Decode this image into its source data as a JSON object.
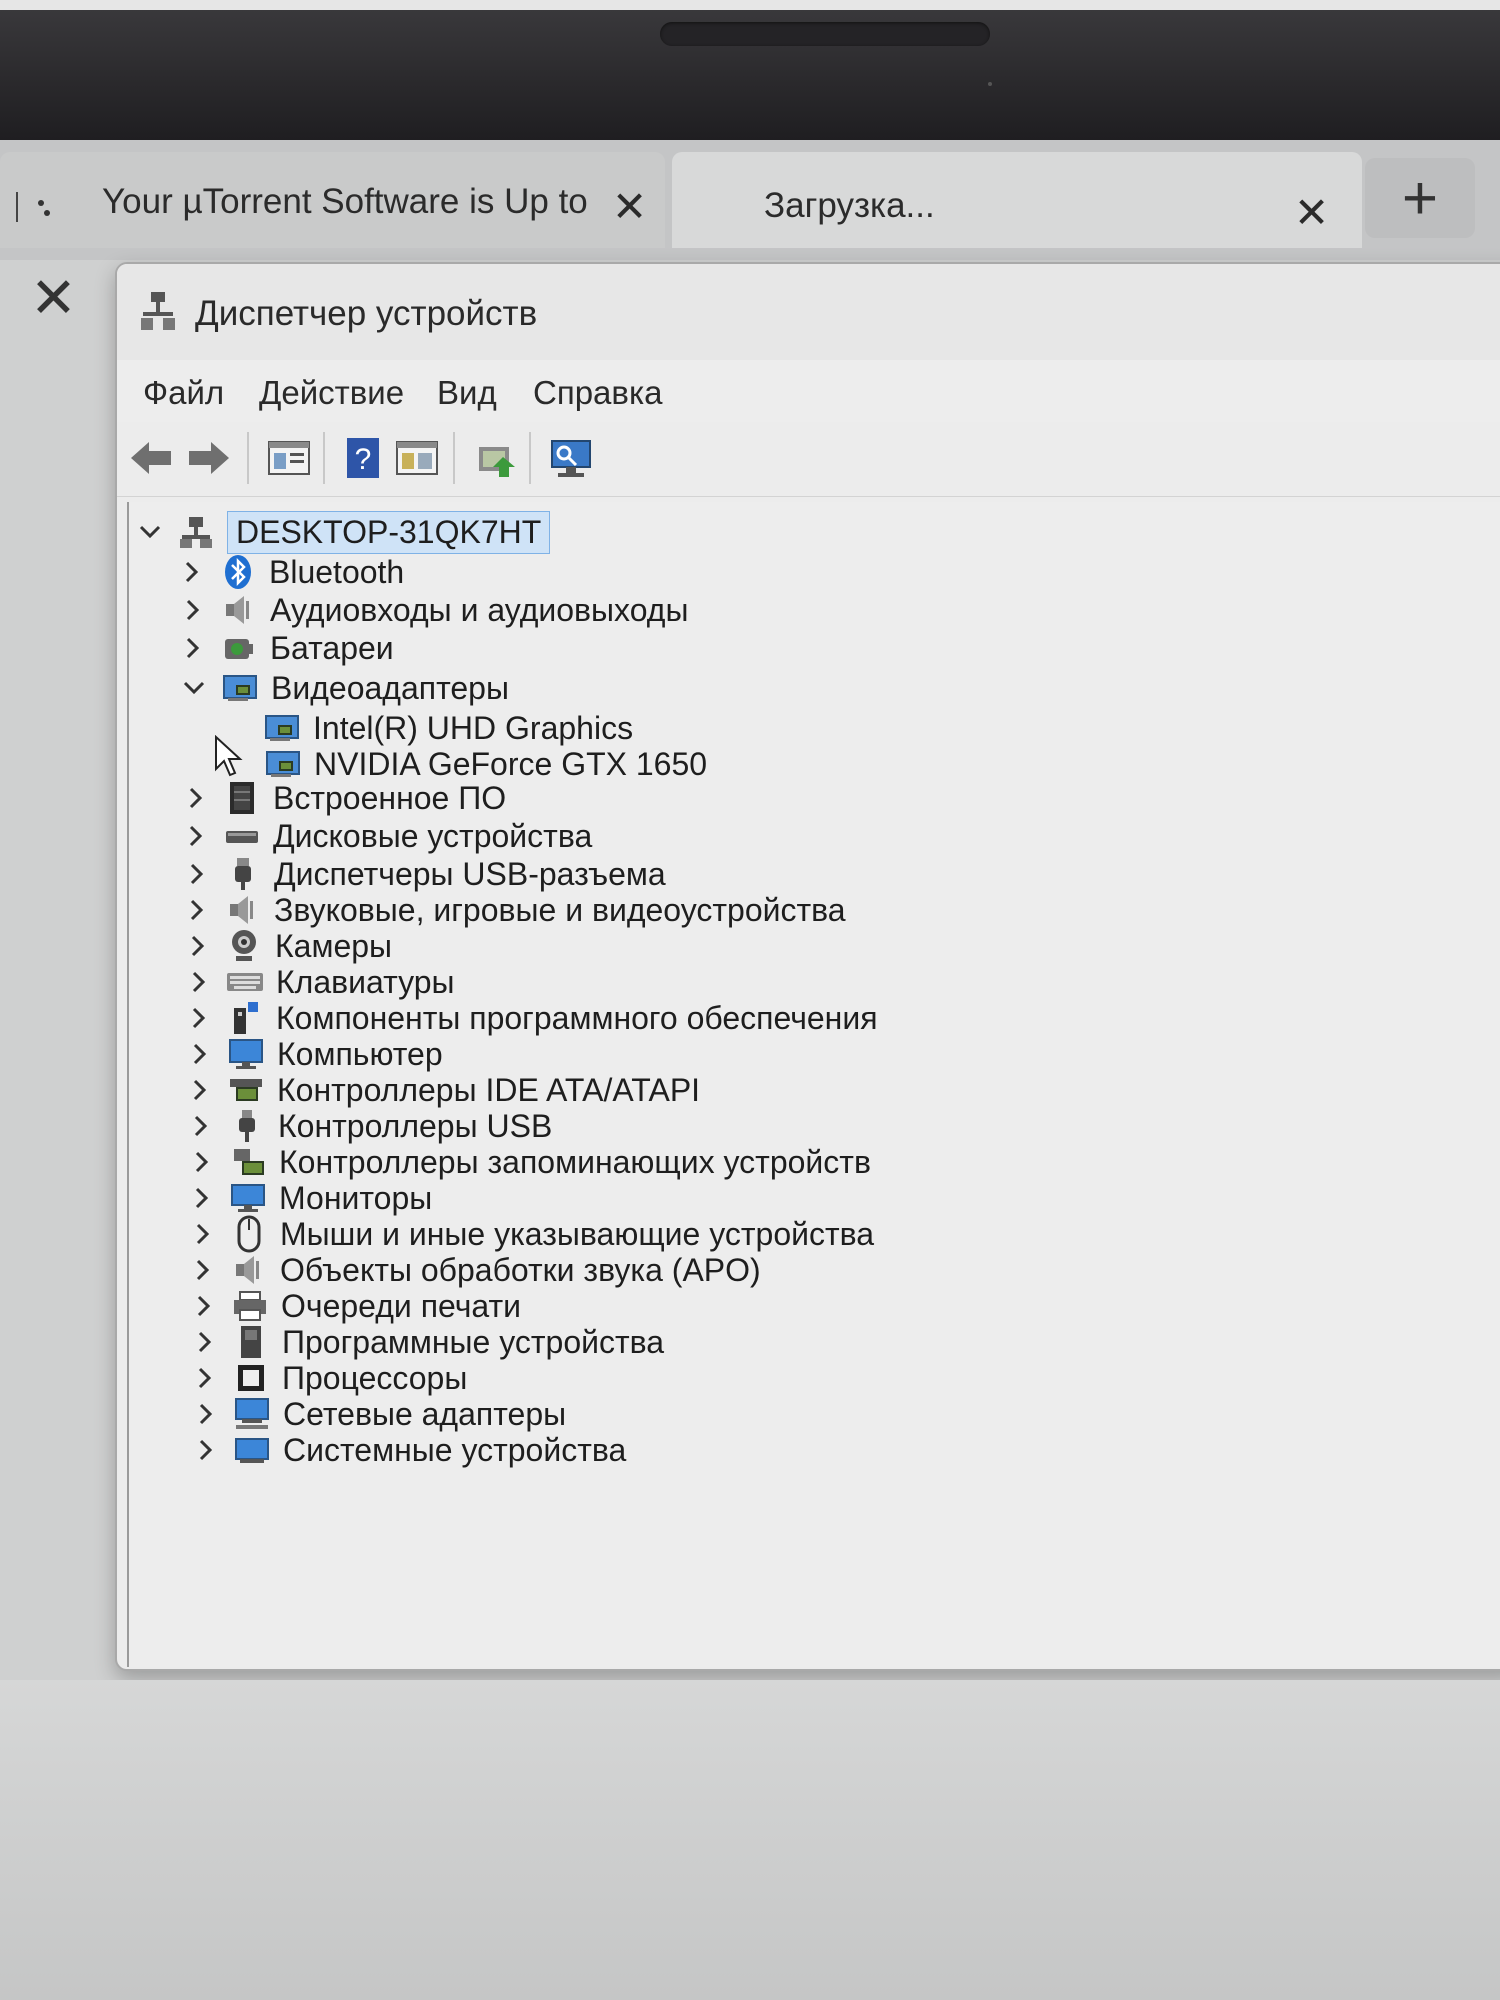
{
  "browser": {
    "tabs": [
      {
        "title": "Your µTorrent Software is Up to D",
        "close": "✕"
      },
      {
        "title": "Загрузка...",
        "close": "✕"
      }
    ],
    "new_tab": "+",
    "side_close": "✕"
  },
  "window": {
    "title": "Диспетчер устройств",
    "menu": [
      "Файл",
      "Действие",
      "Вид",
      "Справка"
    ],
    "toolbar_icons": [
      "back-arrow-icon",
      "forward-arrow-icon",
      "properties-icon",
      "help-icon",
      "action-pane-icon",
      "update-driver-icon",
      "monitor-scan-icon"
    ]
  },
  "tree": {
    "root": {
      "label": "DESKTOP-31QK7HT",
      "expanded": true
    },
    "items": [
      {
        "label": "Bluetooth",
        "icon": "bluetooth-icon"
      },
      {
        "label": "Аудиовходы и аудиовыходы",
        "icon": "speaker-icon"
      },
      {
        "label": "Батареи",
        "icon": "battery-icon"
      },
      {
        "label": "Видеоадаптеры",
        "icon": "display-adapter-icon",
        "expanded": true
      },
      {
        "label": "Intel(R) UHD Graphics",
        "icon": "display-adapter-icon",
        "child": true
      },
      {
        "label": "NVIDIA GeForce GTX 1650",
        "icon": "display-adapter-icon",
        "child": true
      },
      {
        "label": "Встроенное ПО",
        "icon": "firmware-icon"
      },
      {
        "label": "Дисковые устройства",
        "icon": "disk-icon"
      },
      {
        "label": "Диспетчеры USB-разъема",
        "icon": "usb-connector-icon"
      },
      {
        "label": "Звуковые, игровые и видеоустройства",
        "icon": "speaker-icon"
      },
      {
        "label": "Камеры",
        "icon": "camera-icon"
      },
      {
        "label": "Клавиатуры",
        "icon": "keyboard-icon"
      },
      {
        "label": "Компоненты программного обеспечения",
        "icon": "software-component-icon"
      },
      {
        "label": "Компьютер",
        "icon": "computer-icon"
      },
      {
        "label": "Контроллеры IDE ATA/ATAPI",
        "icon": "ide-controller-icon"
      },
      {
        "label": "Контроллеры USB",
        "icon": "usb-icon"
      },
      {
        "label": "Контроллеры запоминающих устройств",
        "icon": "storage-controller-icon"
      },
      {
        "label": "Мониторы",
        "icon": "monitor-icon"
      },
      {
        "label": "Мыши и иные указывающие устройства",
        "icon": "mouse-icon"
      },
      {
        "label": "Объекты обработки звука (APO)",
        "icon": "speaker-icon"
      },
      {
        "label": "Очереди печати",
        "icon": "printer-icon"
      },
      {
        "label": "Программные устройства",
        "icon": "software-device-icon"
      },
      {
        "label": "Процессоры",
        "icon": "processor-icon"
      },
      {
        "label": "Сетевые адаптеры",
        "icon": "network-adapter-icon"
      },
      {
        "label": "Системные устройства",
        "icon": "system-device-icon"
      }
    ]
  }
}
